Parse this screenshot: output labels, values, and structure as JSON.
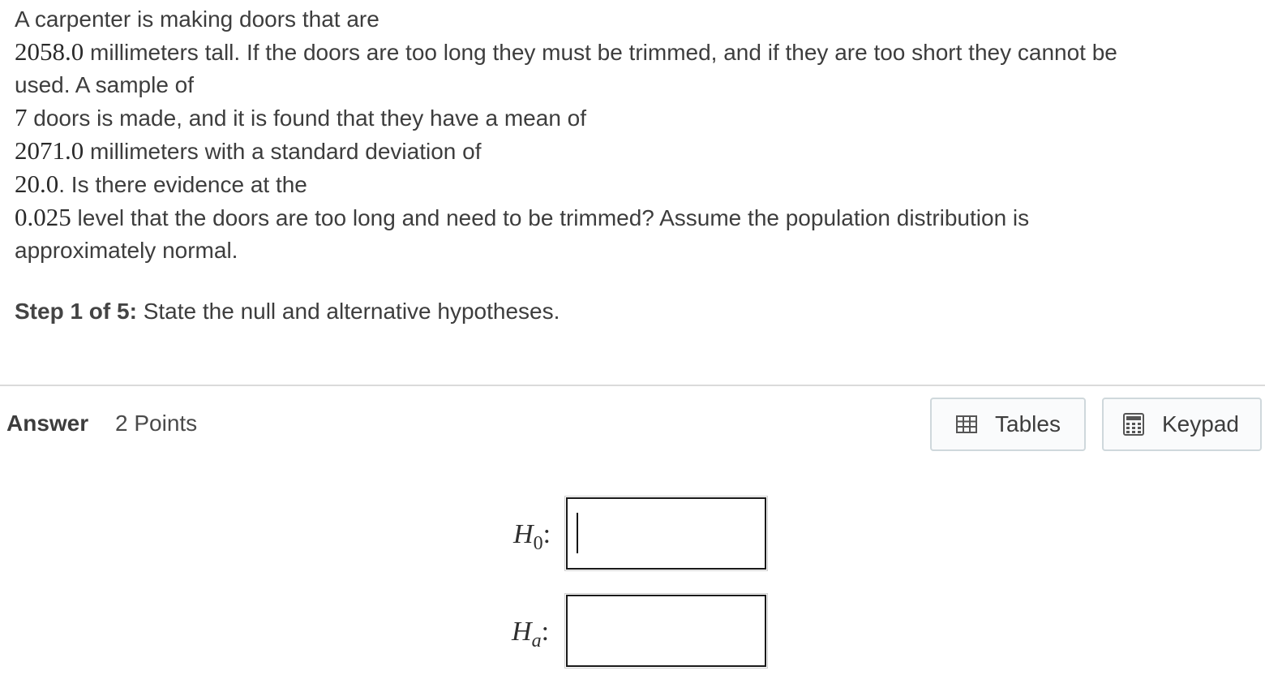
{
  "question": {
    "l1_text": "A carpenter is making doors that are",
    "l2_num": "2058.0",
    "l2_text": " millimeters tall. If the doors are too long they must be trimmed, and if they are too short they cannot be",
    "l3_text": "used. A sample of",
    "l4_num": "7",
    "l4_text": " doors is made, and it is found that they have a mean of",
    "l5_num": "2071.0",
    "l5_text": " millimeters with a standard deviation of",
    "l6_num": "20.0",
    "l6_text": ". Is there evidence at the",
    "l7_num": "0.025",
    "l7_text": " level that the doors are too long and need to be trimmed? Assume the population distribution is",
    "l8_text": "approximately normal."
  },
  "step": {
    "label": "Step 1 of 5:",
    "text": " State the null and alternative hypotheses."
  },
  "answer": {
    "label": "Answer",
    "points": "2 Points"
  },
  "toolbar": {
    "tables_label": "Tables",
    "keypad_label": "Keypad",
    "tables_icon": "table-grid-icon",
    "keypad_icon": "calculator-icon"
  },
  "hypotheses": {
    "null_symbol": "H",
    "null_sub": "0",
    "alt_symbol": "H",
    "alt_sub": "a",
    "colon": ":",
    "null_value": "",
    "alt_value": ""
  }
}
